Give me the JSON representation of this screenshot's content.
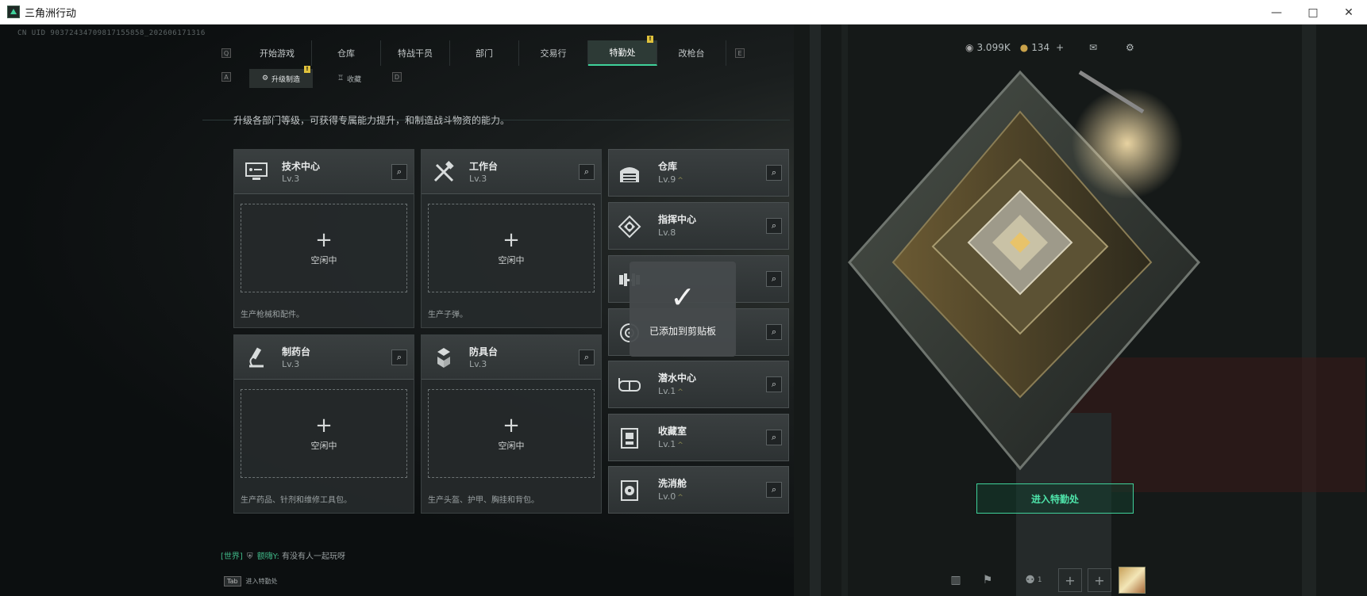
{
  "window": {
    "title": "三角洲行动",
    "minimize": "—",
    "maximize": "□",
    "close": "✕"
  },
  "uid": "CN UID 90372434709817155858_202606171316",
  "nav": {
    "left_key": "Q",
    "right_key": "E",
    "tabs": [
      "开始游戏",
      "仓库",
      "特战干员",
      "部门",
      "交易行",
      "特勤处",
      "改枪台"
    ],
    "active": "特勤处",
    "badge": "!"
  },
  "subnav": {
    "left_key": "A",
    "right_key": "D",
    "tabs": [
      "升级制造",
      "收藏"
    ],
    "active": "升级制造",
    "badge": "!"
  },
  "description": "升级各部门等级，可获得专属能力提升，和制造战斗物资的能力。",
  "workshops": [
    {
      "name": "技术中心",
      "level": "Lv.3",
      "icon": "computer-icon",
      "slot_label": "空闲中",
      "footer": "生产枪械和配件。"
    },
    {
      "name": "工作台",
      "level": "Lv.3",
      "icon": "tools-icon",
      "slot_label": "空闲中",
      "footer": "生产子弹。"
    },
    {
      "name": "制药台",
      "level": "Lv.3",
      "icon": "microscope-icon",
      "slot_label": "空闲中",
      "footer": "生产药品、针剂和维修工具包。"
    },
    {
      "name": "防具台",
      "level": "Lv.3",
      "icon": "armor-icon",
      "slot_label": "空闲中",
      "footer": "生产头盔、护甲、胸挂和背包。"
    }
  ],
  "departments": [
    {
      "name": "仓库",
      "level": "Lv.9",
      "icon": "warehouse-icon",
      "upgrade": "^"
    },
    {
      "name": "指挥中心",
      "level": "Lv.8",
      "icon": "command-icon",
      "upgrade": ""
    },
    {
      "name": "",
      "level": "",
      "icon": "dumbbell-icon",
      "upgrade": ""
    },
    {
      "name": "",
      "level": "",
      "icon": "target-icon",
      "upgrade": ""
    },
    {
      "name": "潜水中心",
      "level": "Lv.1",
      "icon": "diving-mask-icon",
      "upgrade": "^"
    },
    {
      "name": "收藏室",
      "level": "Lv.1",
      "icon": "vault-icon",
      "upgrade": "^"
    },
    {
      "name": "洗消舱",
      "level": "Lv.0",
      "icon": "decon-icon",
      "upgrade": "^"
    }
  ],
  "toast": "已添加到剪贴板",
  "enter_button": "进入特勤处",
  "chat": {
    "channel": "[世界]",
    "user": "额嗨Y:",
    "message": "有没有人一起玩呀"
  },
  "tab_hint": {
    "key": "Tab",
    "label": "进入特勤处"
  },
  "currency": {
    "coins": "3.099K",
    "tokens": "134",
    "add": "+"
  },
  "squad_count": "1"
}
